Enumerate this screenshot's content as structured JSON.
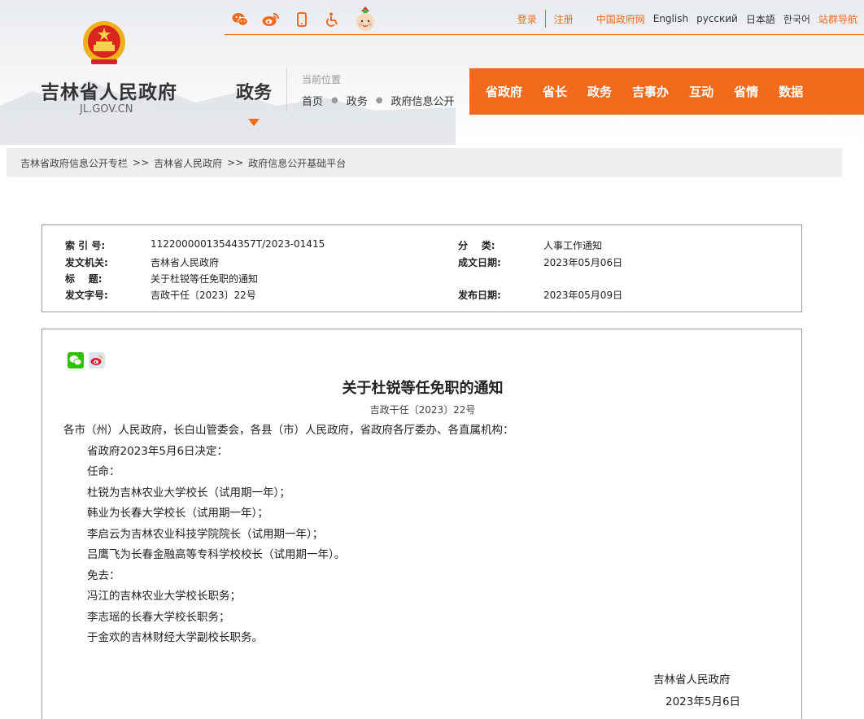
{
  "header": {
    "site_title": "吉林省人民政府",
    "site_domain": "JL.GOV.CN",
    "section_title": "政务",
    "location_label": "当前位置",
    "location_crumbs": [
      "首页",
      "政务",
      "政府信息公开"
    ],
    "social_icons": [
      "wechat-icon",
      "weibo-icon",
      "mobile-icon",
      "accessibility-icon",
      "mascot-icon"
    ],
    "top_links": {
      "login": "登录",
      "register": "注册",
      "gov_cn": "中国政府网",
      "english": "English",
      "russian": "русский",
      "japanese": "日本語",
      "korean": "한국어",
      "site_nav": "站群导航"
    },
    "main_nav": [
      "省政府",
      "省长",
      "政务",
      "吉事办",
      "互动",
      "省情",
      "数据"
    ]
  },
  "breadcrumb": [
    "吉林省政府信息公开专栏",
    "吉林省人民政府",
    "政府信息公开基础平台"
  ],
  "breadcrumb_sep": ">>",
  "meta": {
    "index_label": "索 引 号:",
    "index_value": "11220000013544357T/2023-01415",
    "category_label": "分    类:",
    "category_value": "人事工作通知",
    "issuer_label": "发文机关:",
    "issuer_value": "吉林省人民政府",
    "created_label": "成文日期:",
    "created_value": "2023年05月06日",
    "title_label": "标    题:",
    "title_value": "关于杜锐等任免职的通知",
    "docno_label": "发文字号:",
    "docno_value": "吉政干任〔2023〕22号",
    "published_label": "发布日期:",
    "published_value": "2023年05月09日"
  },
  "article": {
    "title": "关于杜锐等任免职的通知",
    "doc_number": "吉政干任〔2023〕22号",
    "salutation": "各市（州）人民政府，长白山管委会，各县（市）人民政府，省政府各厅委办、各直属机构：",
    "paragraphs": [
      "省政府2023年5月6日决定：",
      "任命：",
      "杜锐为吉林农业大学校长（试用期一年）；",
      "韩业为长春大学校长（试用期一年）；",
      "李启云为吉林农业科技学院院长（试用期一年）；",
      "吕鹰飞为长春金融高等专科学校校长（试用期一年）。",
      "免去：",
      "冯江的吉林农业大学校长职务；",
      "李志瑶的长春大学校长职务；",
      "于金欢的吉林财经大学副校长职务。"
    ],
    "signature": "吉林省人民政府",
    "sign_date": "2023年5月6日"
  },
  "colors": {
    "accent": "#f26a1b",
    "wechat": "#2dc100",
    "weibo": "#e6162d"
  }
}
